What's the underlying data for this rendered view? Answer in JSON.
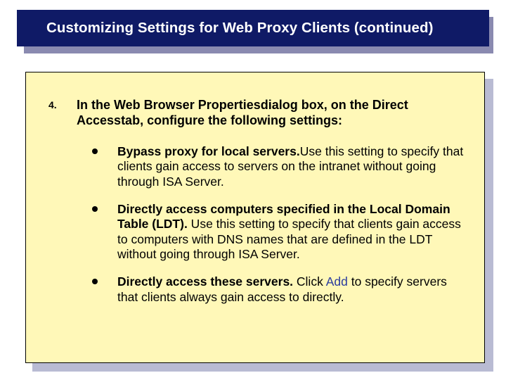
{
  "title": "Customizing Settings for Web Proxy Clients (continued)",
  "step": {
    "number": "4.",
    "lead_parts": {
      "p1": "In the ",
      "p2": "Web Browser Properties",
      "p3": "dialog box, on the ",
      "p4": "Direct Access",
      "p5": "tab, configure the following settings:"
    }
  },
  "bullets": [
    {
      "bold": "Bypass proxy for local servers.",
      "rest": "Use this setting to specify that clients gain access to servers on the intranet without going through ISA Server."
    },
    {
      "bold": "Directly access computers specified in the Local Domain Table (LDT).",
      "rest": " Use this setting to specify that clients gain access to computers with DNS names that are defined in the LDT without going through ISA Server."
    },
    {
      "bold": "Directly access these servers.",
      "rest_pre": " Click ",
      "add": "Add",
      "rest_post": " to specify servers that clients always gain access to directly."
    }
  ]
}
